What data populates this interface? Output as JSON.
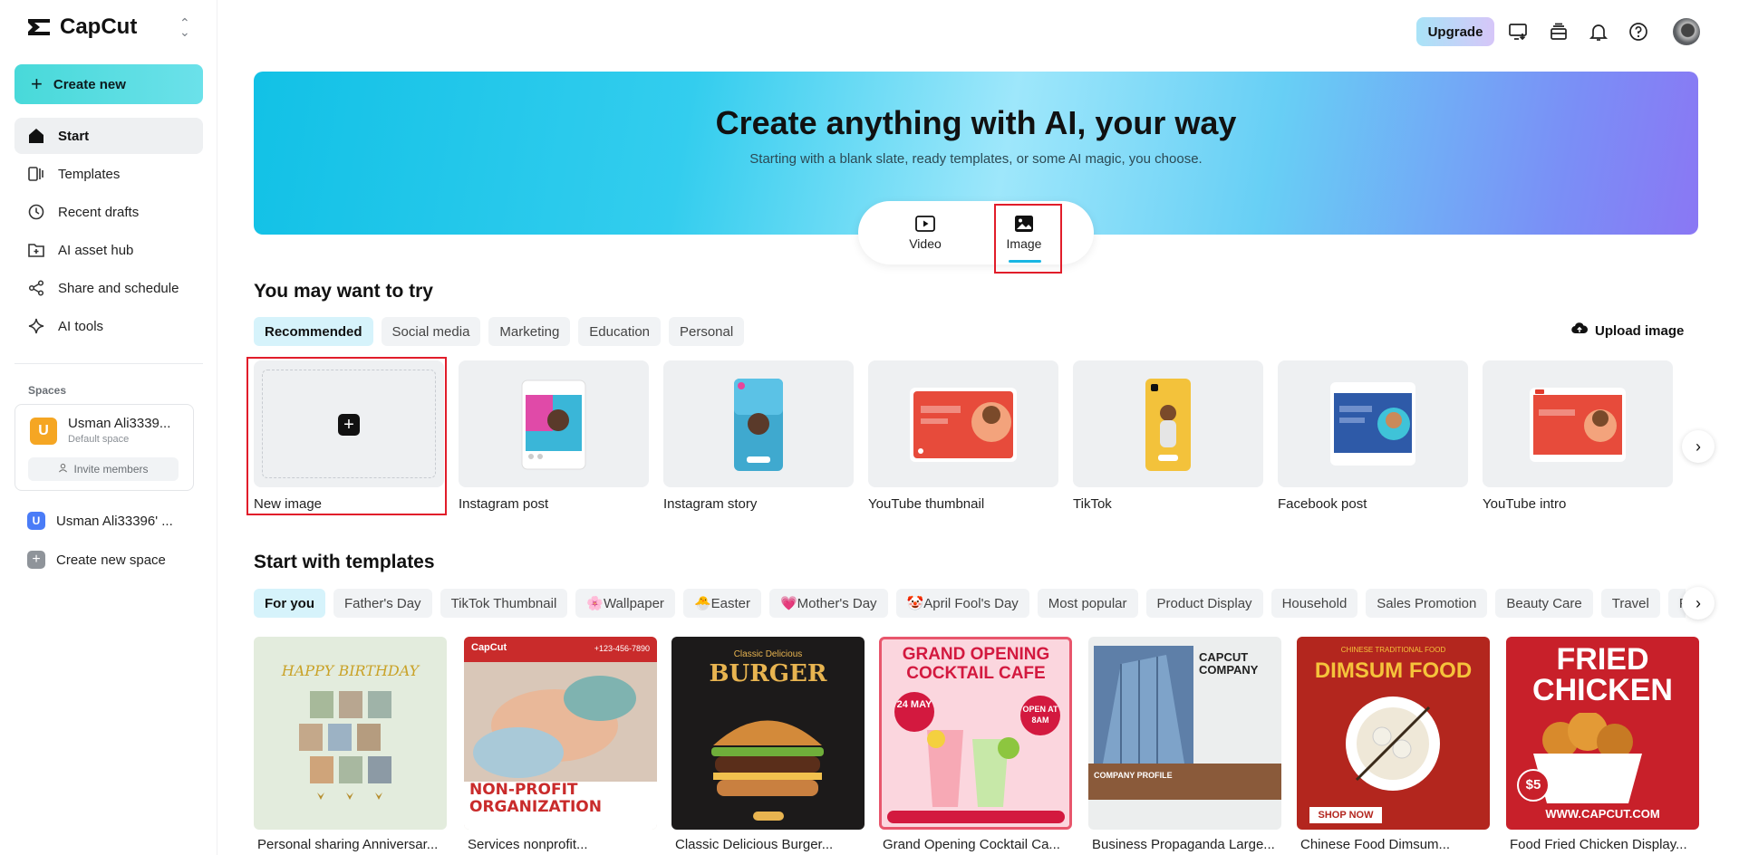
{
  "app": {
    "brand": "CapCut"
  },
  "sidebar": {
    "create_label": "Create new",
    "items": [
      {
        "label": "Start",
        "icon": "home-icon",
        "active": true
      },
      {
        "label": "Templates",
        "icon": "templates-icon"
      },
      {
        "label": "Recent drafts",
        "icon": "clock-icon"
      },
      {
        "label": "AI asset hub",
        "icon": "folder-plus-icon"
      },
      {
        "label": "Share and schedule",
        "icon": "share-icon"
      },
      {
        "label": "AI tools",
        "icon": "sparkle-icon"
      }
    ],
    "spaces_label": "Spaces",
    "space": {
      "avatar": "U",
      "name": "Usman Ali3339...",
      "sub": "Default space",
      "invite": "Invite members"
    },
    "space2": {
      "avatar": "U",
      "name": "Usman Ali33396'  ..."
    },
    "create_space": "Create new space"
  },
  "topbar": {
    "upgrade": "Upgrade"
  },
  "hero": {
    "title": "Create anything with AI, your way",
    "subtitle": "Starting with a blank slate, ready templates, or some AI magic, you choose.",
    "modes": [
      {
        "label": "Video",
        "icon": "play-icon"
      },
      {
        "label": "Image",
        "icon": "image-icon",
        "active": true
      }
    ]
  },
  "try": {
    "title": "You may want to try",
    "tabs": [
      "Recommended",
      "Social media",
      "Marketing",
      "Education",
      "Personal"
    ],
    "upload_label": "Upload image",
    "cards": [
      "New image",
      "Instagram post",
      "Instagram story",
      "YouTube thumbnail",
      "TikTok",
      "Facebook post",
      "YouTube intro"
    ]
  },
  "templates": {
    "title": "Start with templates",
    "tabs": [
      "For you",
      "Father's Day",
      "TikTok Thumbnail",
      "🌸Wallpaper",
      "🐣Easter",
      "💗Mother's Day",
      "🤡April Fool's Day",
      "Most popular",
      "Product Display",
      "Household",
      "Sales Promotion",
      "Beauty Care",
      "Travel",
      "Fo"
    ],
    "items": [
      {
        "caption": "Personal sharing Anniversar...",
        "bg": "#e3ecdd",
        "text": "HAPPY BIRTHDAY",
        "color": "#c9a227"
      },
      {
        "caption": "Services nonprofit...",
        "bg": "#c92b2b",
        "text": "NON-PROFIT ORGANIZATION",
        "color": "#ffffff"
      },
      {
        "caption": "Classic Delicious Burger...",
        "bg": "#1c1a1a",
        "text": "BURGER",
        "color": "#e8b450"
      },
      {
        "caption": "Grand Opening Cocktail Ca...",
        "bg": "#fbd6de",
        "text": "GRAND OPENING COCKTAIL CAFE",
        "color": "#d3193f"
      },
      {
        "caption": "Business Propaganda Large...",
        "bg": "#eceeee",
        "text": "CAPCUT COMPANY",
        "color": "#222222"
      },
      {
        "caption": "Chinese Food Dimsum...",
        "bg": "#b3261e",
        "text": "DIMSUM FOOD",
        "color": "#f5c33b"
      },
      {
        "caption": "Food Fried Chicken Display...",
        "bg": "#c8202a",
        "text": "FRIED CHICKEN",
        "color": "#ffffff"
      }
    ]
  },
  "template_badges": {
    "burger_top": "Classic Delicious",
    "cocktail_date": "24 MAY",
    "cocktail_open": "OPEN AT 8AM",
    "nonprofit_brand": "CapCut",
    "nonprofit_phone": "+123-456-7890",
    "company_profile": "COMPANY PROFILE",
    "dimsum_top": "CHINESE TRADITIONAL FOOD",
    "dimsum_shop": "SHOP NOW",
    "chicken_price": "$5",
    "chicken_url": "WWW.CAPCUT.COM"
  }
}
